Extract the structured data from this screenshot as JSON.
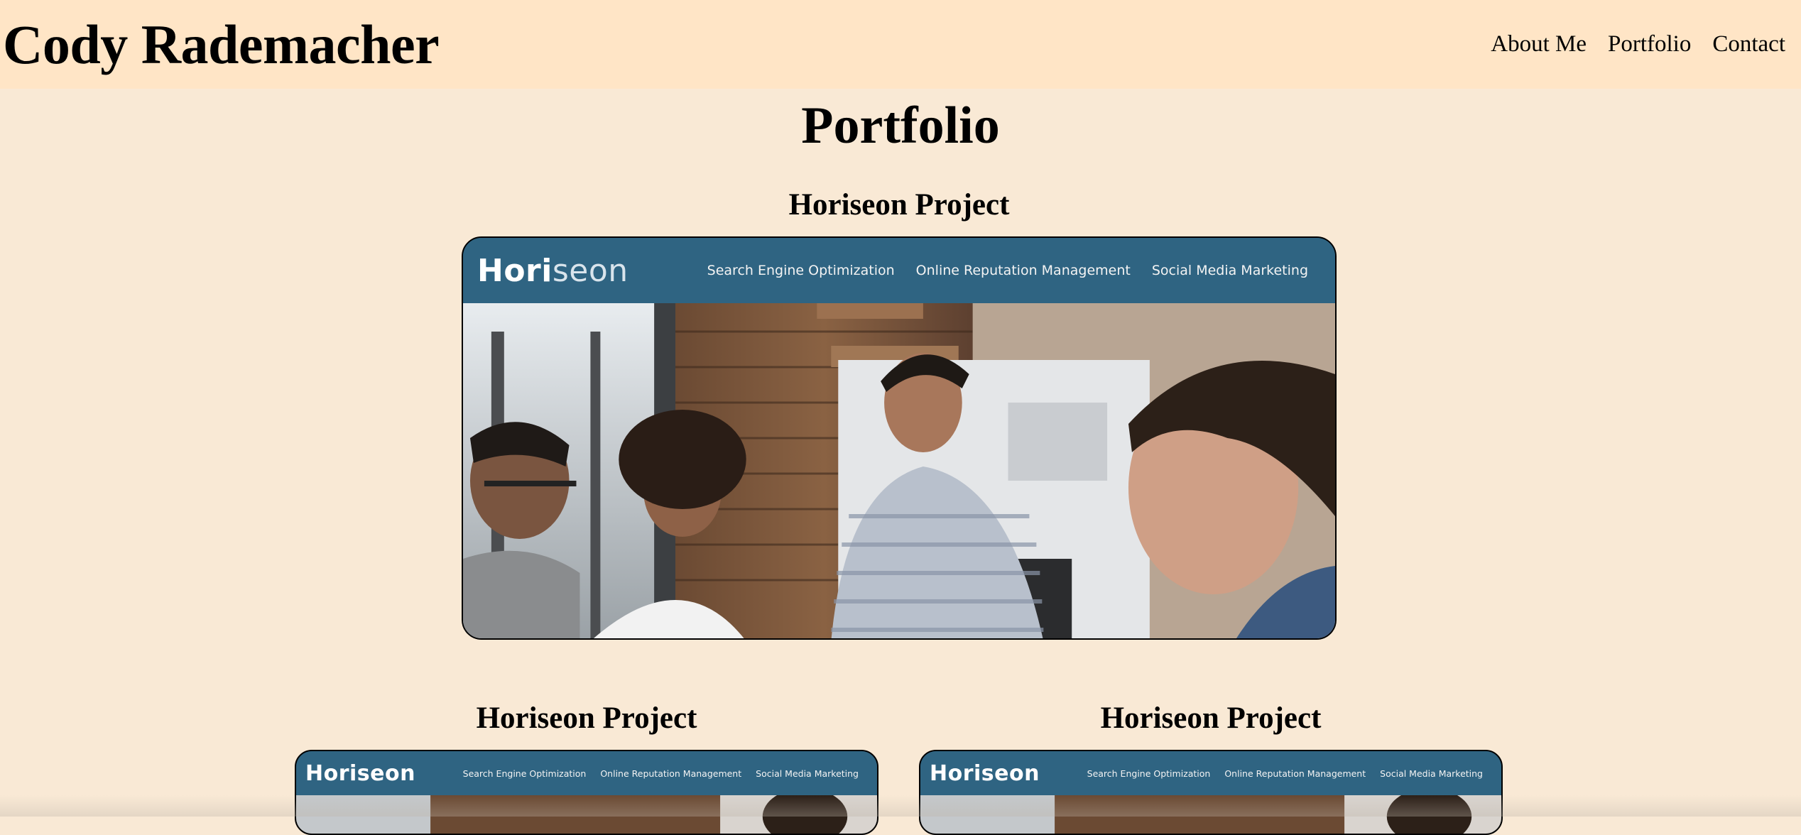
{
  "header": {
    "site_title": "Cody Rademacher",
    "nav": [
      {
        "label": "About Me"
      },
      {
        "label": "Portfolio"
      },
      {
        "label": "Contact"
      }
    ]
  },
  "main": {
    "heading": "Portfolio",
    "projects": [
      {
        "title": "Horiseon Project",
        "preview": {
          "logo_part1": "Hori",
          "logo_part2": "seon",
          "links": [
            "Search Engine Optimization",
            "Online Reputation Management",
            "Social Media Marketing"
          ]
        }
      },
      {
        "title": "Horiseon Project",
        "preview": {
          "logo_part1": "Horiseon",
          "logo_part2": "",
          "links": [
            "Search Engine Optimization",
            "Online Reputation Management",
            "Social Media Marketing"
          ]
        }
      },
      {
        "title": "Horiseon Project",
        "preview": {
          "logo_part1": "Horiseon",
          "logo_part2": "",
          "links": [
            "Search Engine Optimization",
            "Online Reputation Management",
            "Social Media Marketing"
          ]
        }
      }
    ]
  },
  "colors": {
    "page_bg": "#f9e9d5",
    "header_bg": "#ffe5c6",
    "preview_bar": "#2f6482"
  }
}
